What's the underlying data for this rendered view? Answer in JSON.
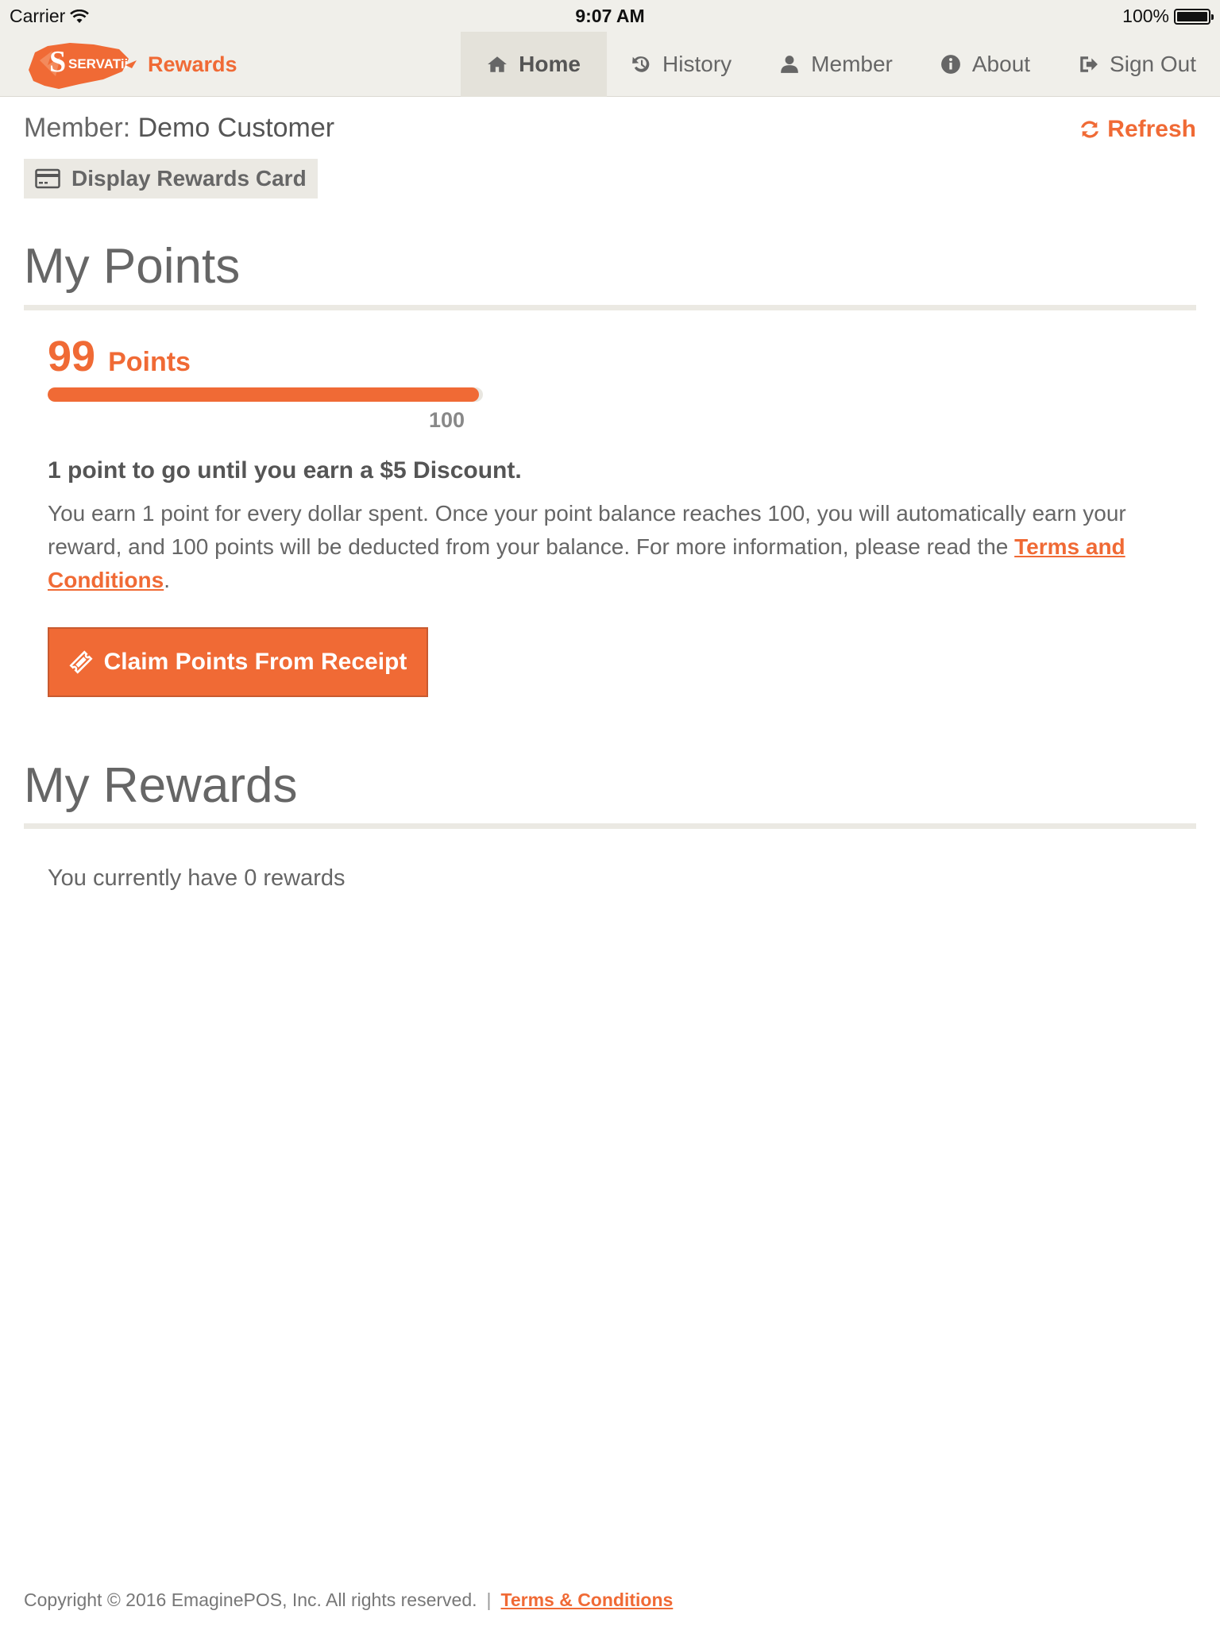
{
  "status_bar": {
    "carrier": "Carrier",
    "time": "9:07 AM",
    "battery": "100%"
  },
  "brand": {
    "logo_text": "SERVATii",
    "text": "Rewards"
  },
  "nav": {
    "home": "Home",
    "history": "History",
    "member": "Member",
    "about": "About",
    "sign_out": "Sign Out"
  },
  "member": {
    "label": "Member: ",
    "name": "Demo Customer",
    "refresh": "Refresh",
    "display_card": "Display Rewards Card"
  },
  "points": {
    "title": "My Points",
    "value": "99",
    "label": "Points",
    "progress_fraction": 0.99,
    "goal": "100",
    "to_go": "1 point to go until you earn a $5 Discount.",
    "info_text": "You earn 1 point for every dollar spent. Once your point balance reaches 100, you will automatically earn your reward, and 100 points will be deducted from your balance. For more information, please read the ",
    "terms_link": "Terms and Conditions",
    "info_end": ".",
    "claim_button": "Claim Points From Receipt"
  },
  "rewards": {
    "title": "My Rewards",
    "empty_text": "You currently have 0 rewards"
  },
  "footer": {
    "copyright": "Copyright © 2016  EmaginePOS, Inc.  All rights reserved.",
    "separator": "|",
    "terms": "Terms & Conditions"
  },
  "colors": {
    "accent": "#f06a35",
    "nav_bg": "#f0efea"
  }
}
